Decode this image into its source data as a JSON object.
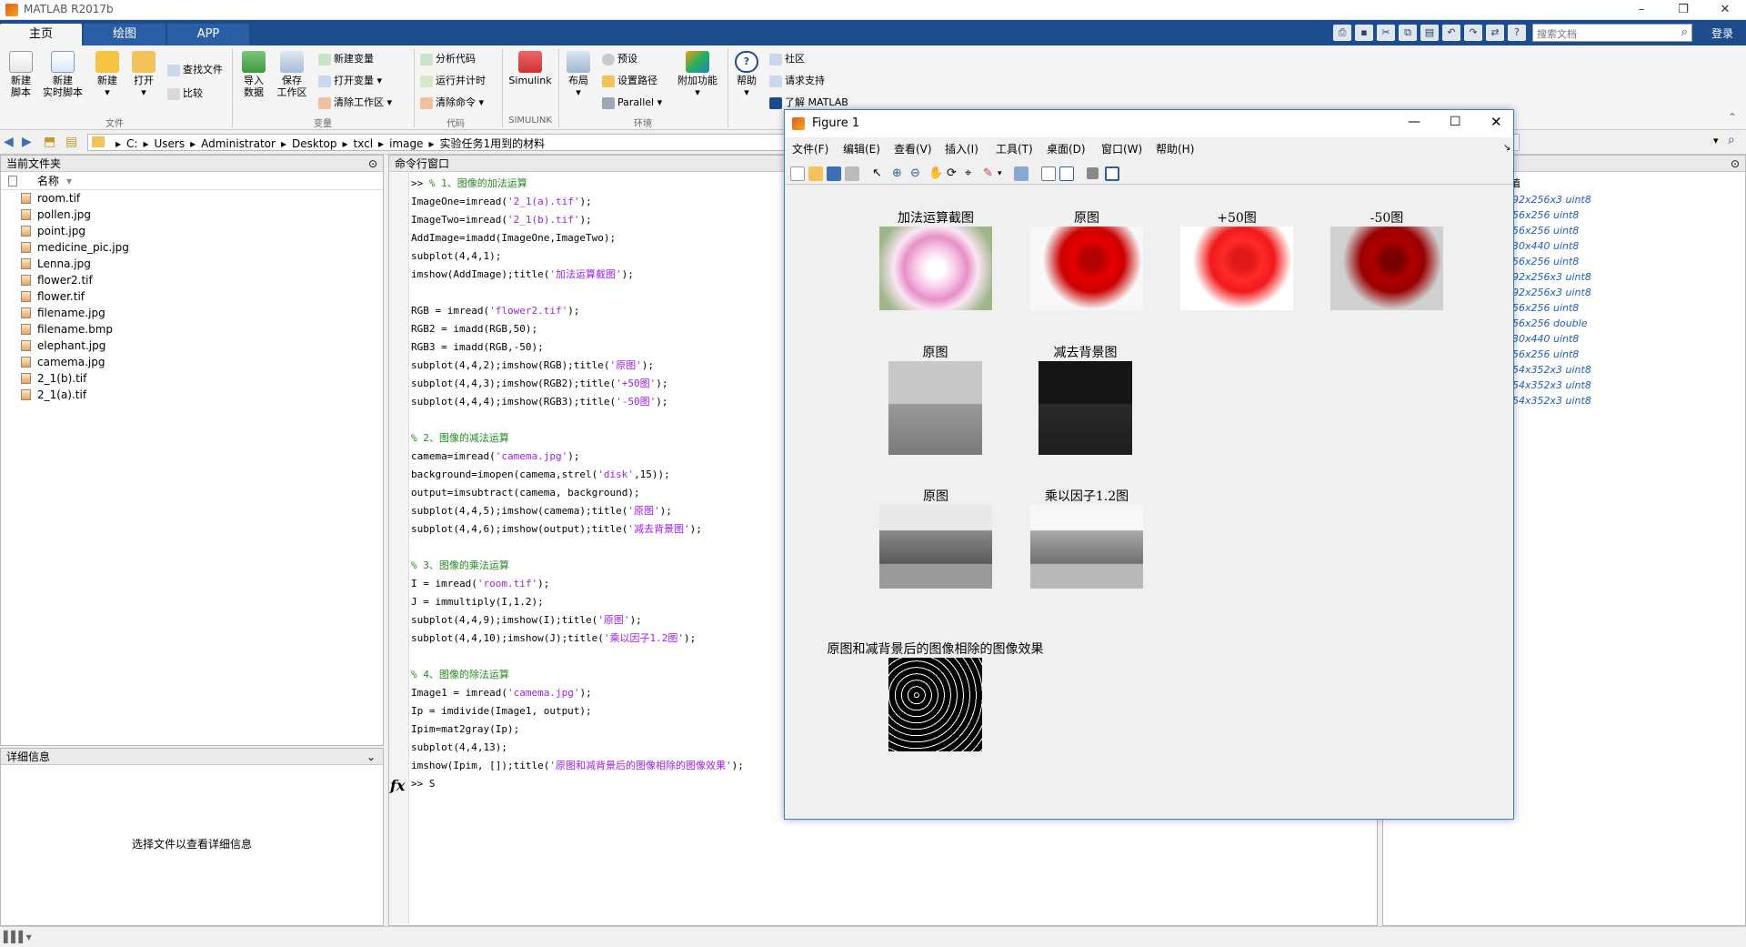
{
  "app": {
    "title": "MATLAB R2017b",
    "login": "登录"
  },
  "tabs": [
    {
      "label": "主页"
    },
    {
      "label": "绘图"
    },
    {
      "label": "APP"
    }
  ],
  "search": {
    "placeholder": "搜索文档"
  },
  "ribbon": {
    "file": {
      "new_script": "新建\n脚本",
      "new_live": "新建\n实时脚本",
      "new": "新建",
      "open": "打开",
      "find_files": "查找文件",
      "compare": "比较",
      "group": "文件"
    },
    "variable": {
      "import": "导入\n数据",
      "save_ws": "保存\n工作区",
      "new_var": "新建变量",
      "open_var": "打开变量",
      "clear_ws": "清除工作区",
      "group": "变量"
    },
    "code": {
      "analyze": "分析代码",
      "run_time": "运行并计时",
      "clear_cmd": "清除命令",
      "group": "代码"
    },
    "simulink": {
      "label": "Simulink",
      "group": "SIMULINK"
    },
    "env": {
      "layout": "布局",
      "prefs": "预设",
      "set_path": "设置路径",
      "parallel": "Parallel",
      "addons": "附加功能",
      "group": "环境"
    },
    "resources": {
      "help": "帮助",
      "community": "社区",
      "support": "请求支持",
      "learn": "了解 MATLAB"
    }
  },
  "path": {
    "crumbs": [
      "C:",
      "Users",
      "Administrator",
      "Desktop",
      "txcl",
      "image",
      "实验任务1用到的材料"
    ]
  },
  "current_folder": {
    "title": "当前文件夹",
    "column": "名称",
    "files": [
      "room.tif",
      "pollen.jpg",
      "point.jpg",
      "medicine_pic.jpg",
      "Lenna.jpg",
      "flower2.tif",
      "flower.tif",
      "filename.jpg",
      "filename.bmp",
      "elephant.jpg",
      "camema.jpg",
      "2_1(b).tif",
      "2_1(a).tif"
    ]
  },
  "details": {
    "title": "详细信息",
    "message": "选择文件以查看详细信息"
  },
  "command_window": {
    "title": "命令行窗口",
    "prompt": ">> ",
    "cursor": "S",
    "fx": "fx",
    "lines": [
      [
        {
          "t": ">> ",
          "c": ""
        },
        {
          "t": "% 1、图像的加法运算",
          "c": "cm"
        }
      ],
      [
        {
          "t": "ImageOne=imread(",
          "c": ""
        },
        {
          "t": "'2_1(a).tif'",
          "c": "str"
        },
        {
          "t": ");",
          "c": ""
        }
      ],
      [
        {
          "t": "ImageTwo=imread(",
          "c": ""
        },
        {
          "t": "'2_1(b).tif'",
          "c": "str"
        },
        {
          "t": ");",
          "c": ""
        }
      ],
      [
        {
          "t": "AddImage=imadd(ImageOne,ImageTwo);",
          "c": ""
        }
      ],
      [
        {
          "t": "subplot(4,4,1);",
          "c": ""
        }
      ],
      [
        {
          "t": "imshow(AddImage);title(",
          "c": ""
        },
        {
          "t": "'加法运算截图'",
          "c": "str"
        },
        {
          "t": ");",
          "c": ""
        }
      ],
      [],
      [
        {
          "t": "RGB = imread(",
          "c": ""
        },
        {
          "t": "'flower2.tif'",
          "c": "str"
        },
        {
          "t": ");",
          "c": ""
        }
      ],
      [
        {
          "t": "RGB2 = imadd(RGB,50);",
          "c": ""
        }
      ],
      [
        {
          "t": "RGB3 = imadd(RGB,-50);",
          "c": ""
        }
      ],
      [
        {
          "t": "subplot(4,4,2);imshow(RGB);title(",
          "c": ""
        },
        {
          "t": "'原图'",
          "c": "str"
        },
        {
          "t": ");",
          "c": ""
        }
      ],
      [
        {
          "t": "subplot(4,4,3);imshow(RGB2);title(",
          "c": ""
        },
        {
          "t": "'+50图'",
          "c": "str"
        },
        {
          "t": ");",
          "c": ""
        }
      ],
      [
        {
          "t": "subplot(4,4,4);imshow(RGB3);title(",
          "c": ""
        },
        {
          "t": "'-50图'",
          "c": "str"
        },
        {
          "t": ");",
          "c": ""
        }
      ],
      [],
      [
        {
          "t": "% 2、图像的减法运算",
          "c": "cm"
        }
      ],
      [
        {
          "t": "camema=imread(",
          "c": ""
        },
        {
          "t": "'camema.jpg'",
          "c": "str"
        },
        {
          "t": ");",
          "c": ""
        }
      ],
      [
        {
          "t": "background=imopen(camema,strel(",
          "c": ""
        },
        {
          "t": "'disk'",
          "c": "str"
        },
        {
          "t": ",15));",
          "c": ""
        }
      ],
      [
        {
          "t": "output=imsubtract(camema, background);",
          "c": ""
        }
      ],
      [
        {
          "t": "subplot(4,4,5);imshow(camema);title(",
          "c": ""
        },
        {
          "t": "'原图'",
          "c": "str"
        },
        {
          "t": ");",
          "c": ""
        }
      ],
      [
        {
          "t": "subplot(4,4,6);imshow(output);title(",
          "c": ""
        },
        {
          "t": "'减去背景图'",
          "c": "str"
        },
        {
          "t": ");",
          "c": ""
        }
      ],
      [],
      [
        {
          "t": "% 3、图像的乘法运算",
          "c": "cm"
        }
      ],
      [
        {
          "t": "I = imread(",
          "c": ""
        },
        {
          "t": "'room.tif'",
          "c": "str"
        },
        {
          "t": ");",
          "c": ""
        }
      ],
      [
        {
          "t": "J = immultiply(I,1.2);",
          "c": ""
        }
      ],
      [
        {
          "t": "subplot(4,4,9);imshow(I);title(",
          "c": ""
        },
        {
          "t": "'原图'",
          "c": "str"
        },
        {
          "t": ");",
          "c": ""
        }
      ],
      [
        {
          "t": "subplot(4,4,10);imshow(J);title(",
          "c": ""
        },
        {
          "t": "'乘以因子1.2图'",
          "c": "str"
        },
        {
          "t": ");",
          "c": ""
        }
      ],
      [],
      [
        {
          "t": "% 4、图像的除法运算",
          "c": "cm"
        }
      ],
      [
        {
          "t": "Image1 = imread(",
          "c": ""
        },
        {
          "t": "'camema.jpg'",
          "c": "str"
        },
        {
          "t": ");",
          "c": ""
        }
      ],
      [
        {
          "t": "Ip = imdivide(Image1, output);",
          "c": ""
        }
      ],
      [
        {
          "t": "Ipim=mat2gray(Ip);",
          "c": ""
        }
      ],
      [
        {
          "t": "subplot(4,4,13);",
          "c": ""
        }
      ],
      [
        {
          "t": "imshow(Ipim, []);title(",
          "c": ""
        },
        {
          "t": "'原图和减背景后的图像相除的图像效果'",
          "c": "str"
        },
        {
          "t": ");",
          "c": ""
        }
      ]
    ]
  },
  "workspace": {
    "header": "值",
    "values": [
      "92x256x3 uint8",
      "56x256 uint8",
      "56x256 uint8",
      "30x440 uint8",
      "56x256 uint8",
      "92x256x3 uint8",
      "92x256x3 uint8",
      "56x256 uint8",
      "56x256 double",
      "30x440 uint8",
      "56x256 uint8",
      "54x352x3 uint8",
      "54x352x3 uint8",
      "54x352x3 uint8"
    ]
  },
  "figure": {
    "title": "Figure 1",
    "menus": [
      "文件(F)",
      "编辑(E)",
      "查看(V)",
      "插入(I)",
      "工具(T)",
      "桌面(D)",
      "窗口(W)",
      "帮助(H)"
    ],
    "subplots": [
      {
        "title": "加法运算截图",
        "kind": "flower"
      },
      {
        "title": "原图",
        "kind": "rose"
      },
      {
        "title": "+50图",
        "kind": "rose-light"
      },
      {
        "title": "-50图",
        "kind": "rose-dark"
      },
      {
        "title": "原图",
        "kind": "camera"
      },
      {
        "title": "减去背景图",
        "kind": "camera-dark"
      },
      {
        "title": "原图",
        "kind": "house"
      },
      {
        "title": "乘以因子1.2图",
        "kind": "house-light"
      },
      {
        "title": "原图和减背景后的图像相除的图像效果",
        "kind": "noise"
      }
    ]
  }
}
